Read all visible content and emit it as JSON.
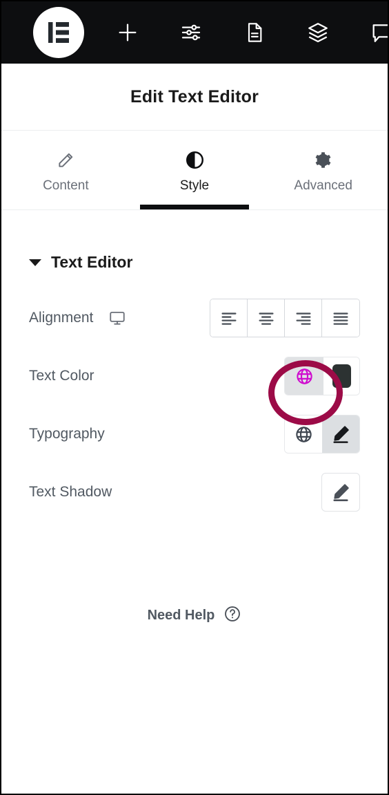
{
  "toolbar": {
    "logo": {
      "name": "elementor-logo",
      "label": "Elementor"
    },
    "items": [
      {
        "icon": "plus-icon",
        "label": "Add Element"
      },
      {
        "icon": "sliders-icon",
        "label": "Settings"
      },
      {
        "icon": "document-icon",
        "label": "Page Settings"
      },
      {
        "icon": "layers-icon",
        "label": "Navigator"
      },
      {
        "icon": "chat-icon",
        "label": "Feedback"
      }
    ]
  },
  "panel": {
    "title": "Edit Text Editor"
  },
  "tabs": [
    {
      "label": "Content",
      "icon": "pencil-icon",
      "active": false
    },
    {
      "label": "Style",
      "icon": "contrast-icon",
      "active": true
    },
    {
      "label": "Advanced",
      "icon": "gear-icon",
      "active": false
    }
  ],
  "section": {
    "title": "Text Editor",
    "expanded": true,
    "caret": "caret-down-icon"
  },
  "controls": {
    "alignment": {
      "label": "Alignment",
      "responsive_icon": "desktop-icon",
      "options": [
        {
          "value": "left",
          "icon": "align-left-icon",
          "selected": false
        },
        {
          "value": "center",
          "icon": "align-center-icon",
          "selected": false
        },
        {
          "value": "right",
          "icon": "align-right-icon",
          "selected": false
        },
        {
          "value": "justify",
          "icon": "align-justify-icon",
          "selected": false
        }
      ]
    },
    "text_color": {
      "label": "Text Color",
      "globe_icon": "globe-icon",
      "globe_color": "#cf0ccf",
      "globe_active": true,
      "swatch_color": "#2c3232",
      "highlighted": true
    },
    "typography": {
      "label": "Typography",
      "globe_icon": "globe-icon",
      "edit_icon": "pencil-icon",
      "edit_active": true
    },
    "text_shadow": {
      "label": "Text Shadow",
      "edit_icon": "pencil-icon"
    }
  },
  "help": {
    "label": "Need Help",
    "icon": "question-circle-icon"
  },
  "annotation": {
    "highlight_color": "#9c0b47",
    "target": "text-color-globe-button"
  }
}
